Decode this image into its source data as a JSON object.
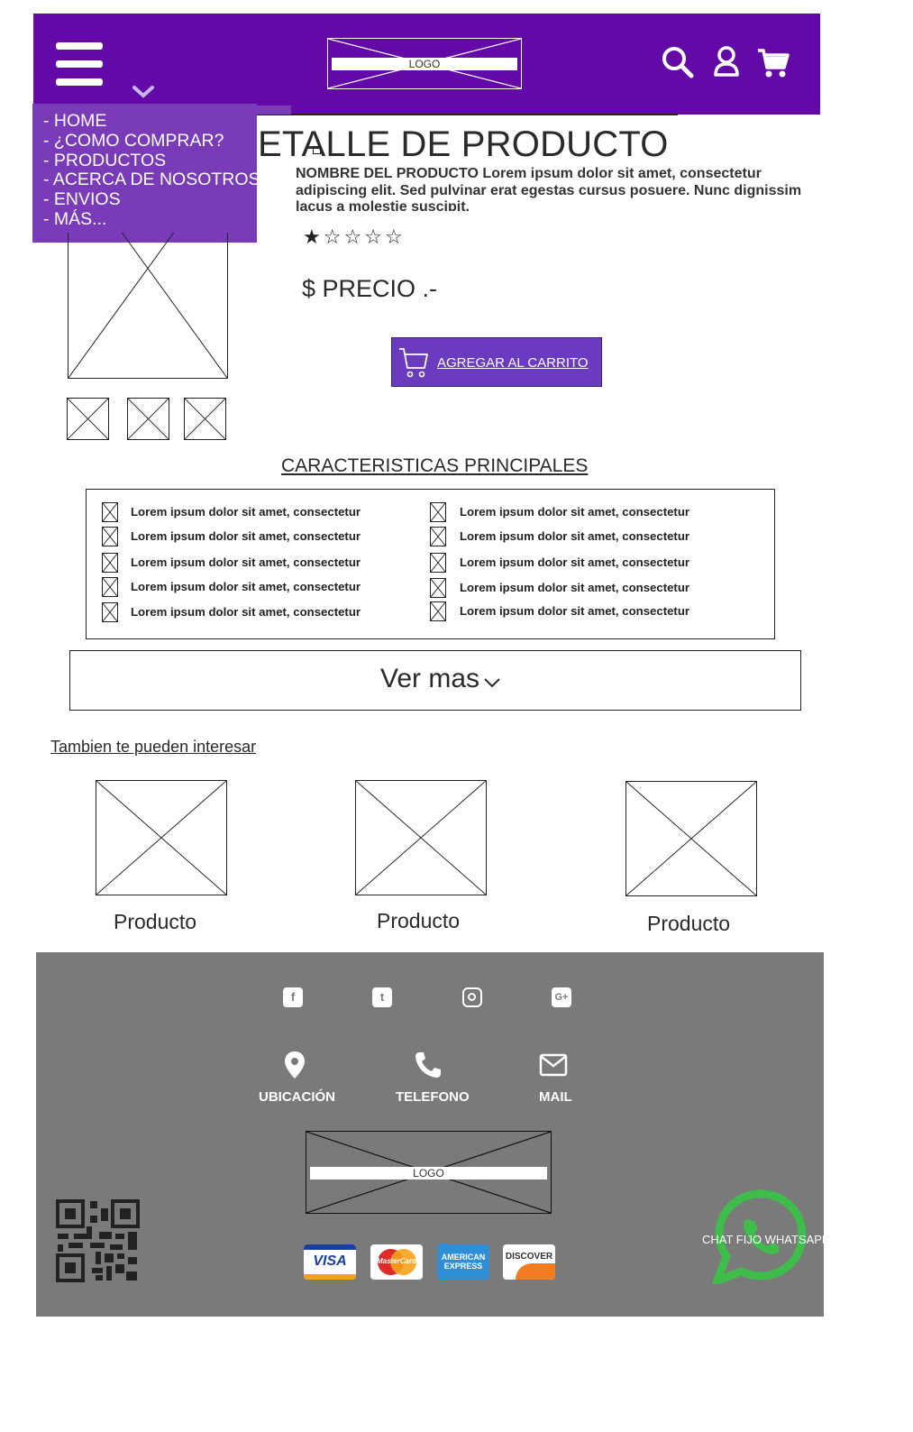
{
  "header": {
    "logo_text": "LOGO",
    "icons": [
      "menu-icon",
      "chevron-down-icon",
      "search-icon",
      "user-icon",
      "cart-icon"
    ]
  },
  "menu": {
    "items": [
      "- HOME",
      "- ¿COMO COMPRAR?",
      "- PRODUCTOS",
      "- ACERCA DE NOSOTROS",
      "- ENVIOS",
      "- MÁS..."
    ]
  },
  "product": {
    "title": "ETALLE DE PRODUCTO",
    "description": "NOMBRE DEL PRODUCTO  Lorem ipsum dolor sit amet, consectetur adipiscing elit. Sed pulvinar erat egestas cursus posuere. Nunc dignissim lacus a molestie suscipit.",
    "rating": 1,
    "rating_max": 5,
    "price": "$ PRECIO .-",
    "add_to_cart": "AGREGAR AL CARRITO"
  },
  "features": {
    "title": "CARACTERISTICAS PRINCIPALES",
    "left": [
      "Lorem ipsum dolor sit amet, consectetur",
      "Lorem ipsum dolor sit amet, consectetur",
      "Lorem ipsum dolor sit amet, consectetur",
      "Lorem ipsum dolor sit amet, consectetur",
      "Lorem ipsum dolor sit amet, consectetur"
    ],
    "right": [
      "Lorem ipsum dolor sit amet, consectetur",
      "Lorem ipsum dolor sit amet, consectetur",
      "Lorem ipsum dolor sit amet, consectetur",
      "Lorem ipsum dolor sit amet, consectetur",
      "Lorem ipsum dolor sit amet, consectetur"
    ]
  },
  "ver_mas": "Ver mas",
  "related": {
    "title": "Tambien te pueden interesar",
    "products": [
      "Producto",
      "Producto",
      "Producto"
    ]
  },
  "footer": {
    "social_icons": [
      "facebook-icon",
      "twitter-icon",
      "instagram-icon",
      "google-plus-icon"
    ],
    "contact": {
      "location": "UBICACIÓN",
      "phone": "TELEFONO",
      "mail": "MAIL"
    },
    "logo_text": "LOGO",
    "payment_cards": {
      "visa": "VISA",
      "mastercard": "MasterCard",
      "amex": "AMERICAN EXPRESS",
      "discover": "DISCOVER"
    },
    "whatsapp_label": "CHAT FIJO WHATSAPP",
    "colors": {
      "header": "#6309a8",
      "menu": "#7a3bb8",
      "button": "#6b3bbf",
      "footer": "#7a7a7a",
      "whatsapp": "#3ebd4a"
    }
  }
}
